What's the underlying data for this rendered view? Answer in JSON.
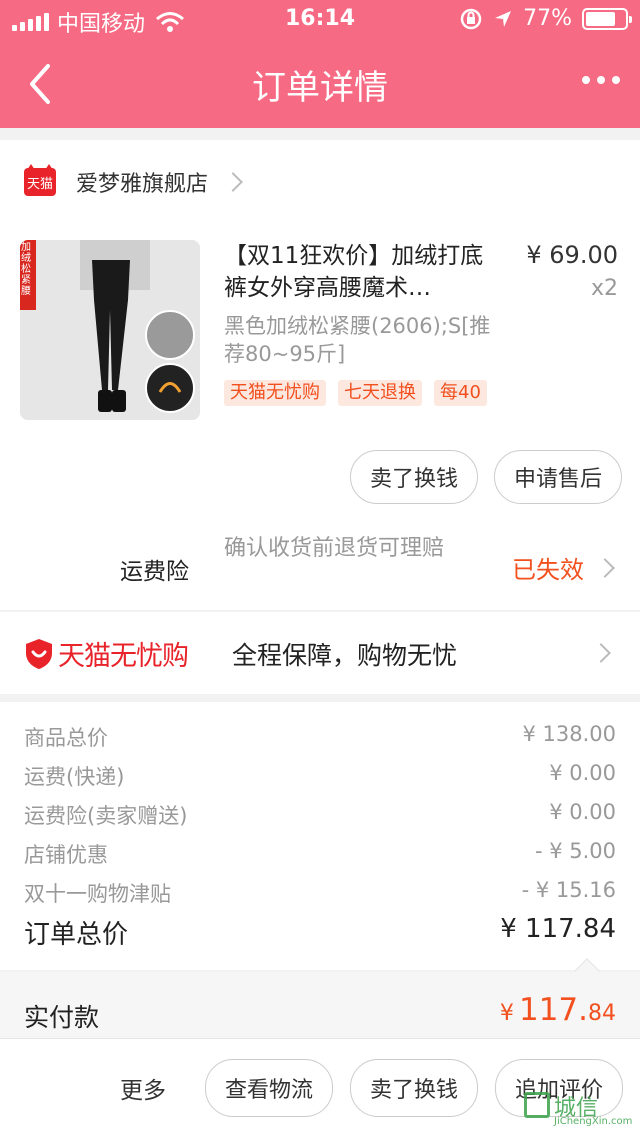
{
  "status_bar": {
    "carrier": "中国移动",
    "time": "16:14",
    "battery": "77%",
    "battery_level": 0.77,
    "icons": [
      "signal-icon",
      "wifi-icon",
      "rotation-lock-icon",
      "location-icon",
      "battery-icon"
    ]
  },
  "nav": {
    "title": "订单详情",
    "back_icon": "chevron-left-icon",
    "more_icon": "more-dots-icon"
  },
  "shop": {
    "badge": "天猫",
    "name": "爱梦雅旗舰店"
  },
  "product": {
    "thumb_caption": "加绒松紧腰",
    "title": "【双11狂欢价】加绒打底裤女外穿高腰魔术…",
    "price": "¥ 69.00",
    "quantity": "x2",
    "sku": "黑色加绒松紧腰(2606);S[推荐80~95斤]",
    "tags": [
      "天猫无忧购",
      "七天退换",
      "每40"
    ]
  },
  "item_actions": {
    "resell": "卖了换钱",
    "after_sale": "申请售后"
  },
  "insurance": {
    "label": "运费险",
    "description": "确认收货前退货可理赔",
    "status": "已失效"
  },
  "guarantee": {
    "brand": "天猫无忧购",
    "slogan": "全程保障，购物无忧"
  },
  "summary": {
    "rows": [
      {
        "label": "商品总价",
        "value": "¥ 138.00"
      },
      {
        "label": "运费(快递)",
        "value": "¥ 0.00"
      },
      {
        "label": "运费险(卖家赠送)",
        "value": "¥ 0.00"
      },
      {
        "label": "店铺优惠",
        "value": "- ¥ 5.00"
      },
      {
        "label": "双十一购物津贴",
        "value": "- ¥ 15.16"
      }
    ],
    "total_label": "订单总价",
    "total_value": "¥ 117.84"
  },
  "paid": {
    "label": "实付款",
    "symbol": "¥",
    "integer": "117.",
    "decimal": "84"
  },
  "bottom_bar": {
    "more": "更多",
    "logistics": "查看物流",
    "resell": "卖了换钱",
    "review": "追加评价"
  },
  "watermark": {
    "text": "城信",
    "sub": "JiChengXin.com"
  },
  "colors": {
    "header": "#f66a83",
    "accent": "#f2501e",
    "tmall_red": "#e8232a"
  }
}
